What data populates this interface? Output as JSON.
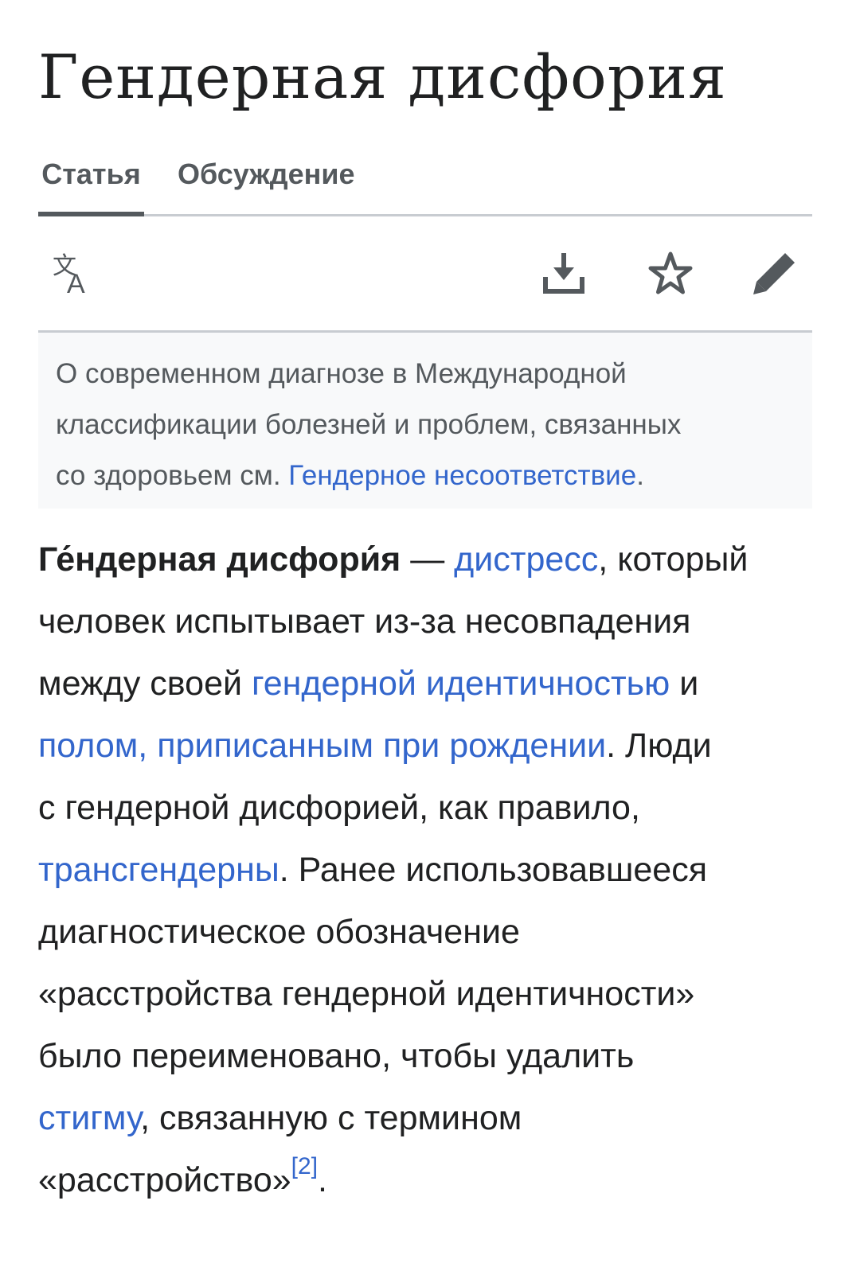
{
  "page": {
    "title": "Гендерная дисфория"
  },
  "tabs": [
    {
      "label": "Статья",
      "selected": true
    },
    {
      "label": "Обсуждение",
      "selected": false
    }
  ],
  "toolbar": {
    "icons": [
      "language-icon",
      "download-icon",
      "star-icon",
      "edit-pencil-icon"
    ]
  },
  "hatnote": {
    "line1": "О современном диагнозе в Международной",
    "line2": "классификации болезней и проблем, связанных",
    "line3_text": "со здоровьем см. ",
    "line3_link": "Гендерное несоответствие",
    "line3_end": "."
  },
  "lead": {
    "l1_bold": "Ге́ндерная дисфори́я",
    "l1_dash": " — ",
    "l1_link": "дистресс",
    "l1_end": ", который",
    "l2": "человек испытывает из-за несовпадения",
    "l3_text": "между своей ",
    "l3_link": "гендерной идентичностью",
    "l3_end": " и",
    "l4_link": "полом, приписанным при рождении",
    "l4_end": ". Люди",
    "l5": "с гендерной дисфорией, как правило,",
    "l6_link": "трансгендерны",
    "l6_end": ". Ранее использовавшееся",
    "l7": "диагностическое обозначение",
    "l8": "«расстройства гендерной идентичности»",
    "l9": "было переименовано, чтобы удалить",
    "l10_link": "стигму",
    "l10_end": ", связанную с термином",
    "l11_text": "«расстройство»",
    "l11_ref": "[2]",
    "l11_end": "."
  },
  "colors": {
    "text": "#202122",
    "link": "#3366cc",
    "muted": "#54595d",
    "hatnote_bg": "#f8f9fa",
    "border": "#c8ccd1"
  }
}
